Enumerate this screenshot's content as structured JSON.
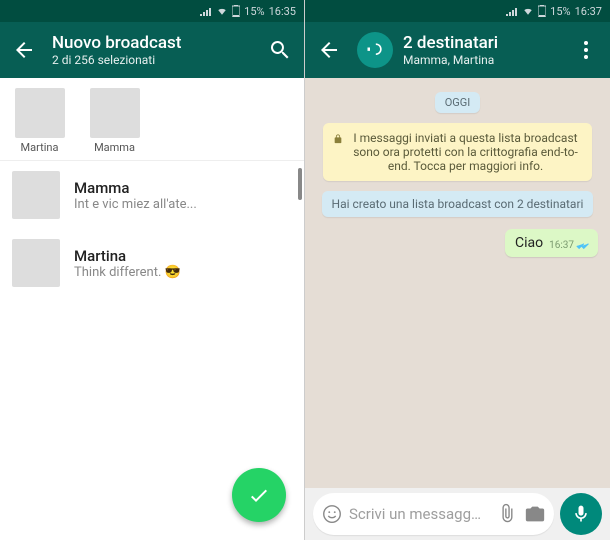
{
  "statusbar": {
    "battery": "15%",
    "time_left": "16:35",
    "time_right": "16:37"
  },
  "left": {
    "header": {
      "title": "Nuovo broadcast",
      "subtitle": "2 di 256 selezionati"
    },
    "selected": [
      {
        "name": "Martina"
      },
      {
        "name": "Mamma"
      }
    ],
    "contacts": [
      {
        "name": "Mamma",
        "status": "Int e vic miez all'ate..."
      },
      {
        "name": "Martina",
        "status": "Think different. 😎"
      }
    ]
  },
  "right": {
    "header": {
      "title": "2 destinatari",
      "subtitle": "Mamma, Martina"
    },
    "date_label": "OGGI",
    "encryption_notice": "I messaggi inviati a questa lista broadcast sono ora protetti con la crittografia end-to-end. Tocca per maggiori info.",
    "creation_notice": "Hai creato una lista broadcast con 2 destinatari",
    "message": {
      "text": "Ciao",
      "time": "16:37"
    },
    "input_placeholder": "Scrivi un messagg…"
  }
}
